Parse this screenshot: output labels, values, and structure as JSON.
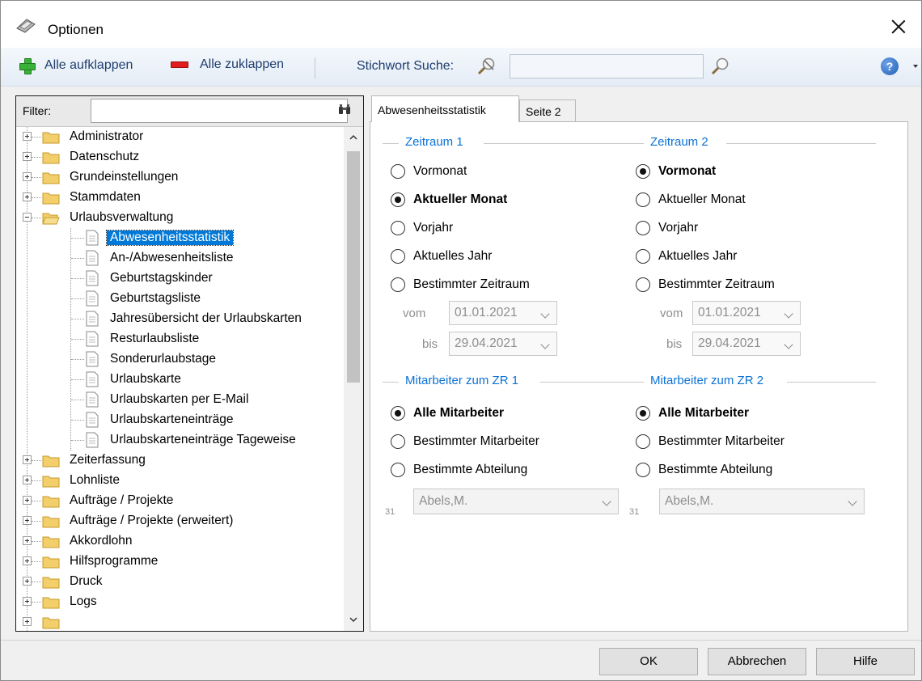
{
  "window": {
    "title": "Optionen"
  },
  "toolbar": {
    "expand_all": "Alle aufklappen",
    "collapse_all": "Alle zuklappen",
    "search_label": "Stichwort Suche:",
    "search_value": ""
  },
  "filter": {
    "label": "Filter:",
    "value": ""
  },
  "tree": {
    "top_before": [
      {
        "label": "Administrator"
      },
      {
        "label": "Datenschutz"
      },
      {
        "label": "Grundeinstellungen"
      },
      {
        "label": "Stammdaten"
      }
    ],
    "open_folder": "Urlaubsverwaltung",
    "children": [
      "Abwesenheitsstatistik",
      "An-/Abwesenheitsliste",
      "Geburtstagskinder",
      "Geburtstagsliste",
      "Jahresübersicht der Urlaubskarten",
      "Resturlaubsliste",
      "Sonderurlaubstage",
      "Urlaubskarte",
      "Urlaubskarten per E-Mail",
      "Urlaubskarteneinträge",
      "Urlaubskarteneinträge Tageweise"
    ],
    "selected_child": "Abwesenheitsstatistik",
    "top_after": [
      "Zeiterfassung",
      "Lohnliste",
      "Aufträge / Projekte",
      "Aufträge / Projekte (erweitert)",
      "Akkordlohn",
      "Hilfsprogramme",
      "Druck",
      "Logs"
    ]
  },
  "tabs": [
    {
      "label": "Abwesenheitsstatistik",
      "active": true
    },
    {
      "label": "Seite 2",
      "active": false
    }
  ],
  "zeitraum1": {
    "title": "Zeitraum 1",
    "options": [
      "Vormonat",
      "Aktueller Monat",
      "Vorjahr",
      "Aktuelles Jahr",
      "Bestimmter Zeitraum"
    ],
    "selected": "Aktueller Monat",
    "vom_label": "vom",
    "vom_value": "01.01.2021",
    "bis_label": "bis",
    "bis_value": "29.04.2021"
  },
  "zeitraum2": {
    "title": "Zeitraum 2",
    "options": [
      "Vormonat",
      "Aktueller Monat",
      "Vorjahr",
      "Aktuelles Jahr",
      "Bestimmter Zeitraum"
    ],
    "selected": "Vormonat",
    "vom_label": "vom",
    "vom_value": "01.01.2021",
    "bis_label": "bis",
    "bis_value": "29.04.2021"
  },
  "mitarbeiter1": {
    "title": "Mitarbeiter zum ZR 1",
    "options": [
      "Alle Mitarbeiter",
      "Bestimmter Mitarbeiter",
      "Bestimmte Abteilung"
    ],
    "selected": "Alle Mitarbeiter",
    "employee": "Abels,M.",
    "num": "31"
  },
  "mitarbeiter2": {
    "title": "Mitarbeiter zum ZR 2",
    "options": [
      "Alle Mitarbeiter",
      "Bestimmter Mitarbeiter",
      "Bestimmte Abteilung"
    ],
    "selected": "Alle Mitarbeiter",
    "employee": "Abels,M.",
    "num": "31"
  },
  "buttons": {
    "ok": "OK",
    "cancel": "Abbrechen",
    "help": "Hilfe"
  },
  "colors": {
    "accent": "#0078d7",
    "group_title": "#0b72d6",
    "folder": "#f2cf6b"
  }
}
